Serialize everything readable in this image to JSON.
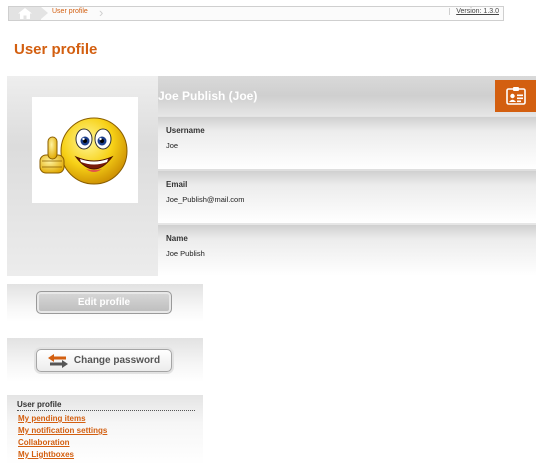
{
  "breadcrumb": {
    "items": [
      "User profile"
    ],
    "version": "Version: 1.3.0"
  },
  "page": {
    "title": "User profile"
  },
  "profile": {
    "display_name": "Joe Publish (Joe)",
    "fields": [
      {
        "label": "Username",
        "value": "Joe"
      },
      {
        "label": "Email",
        "value": "Joe_Publish@mail.com"
      },
      {
        "label": "Name",
        "value": "Joe Publish"
      }
    ]
  },
  "actions": {
    "edit_profile": "Edit profile",
    "change_password": "Change password"
  },
  "menu": {
    "title": "User profile",
    "links": [
      "My pending items",
      "My notification settings",
      "Collaboration",
      "My Lightboxes"
    ]
  },
  "icons": {
    "home": "home-icon",
    "card": "contact-card-icon",
    "swap": "swap-arrows-icon",
    "avatar": "thumbs-up-smiley"
  },
  "colors": {
    "accent": "#d35f10",
    "panel": "#dcdcdc",
    "button_gray": "#bdbdbd"
  }
}
